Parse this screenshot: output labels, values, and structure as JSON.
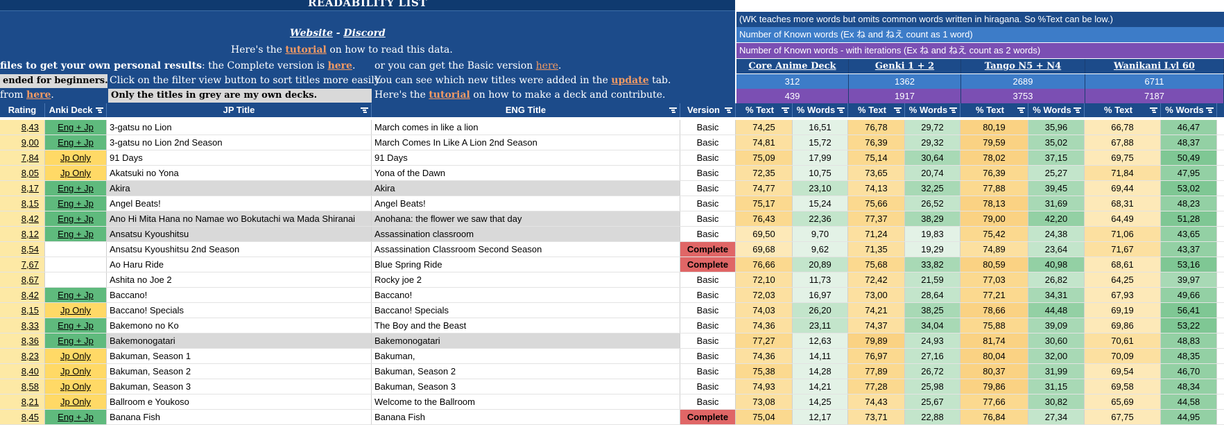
{
  "header": {
    "title": "READABILITY LIST",
    "website": "Website",
    "dash": " - ",
    "discord": "Discord",
    "read_line_pre": "Here's the ",
    "read_link": "tutorial",
    "read_line_post": " on how to read this data.",
    "profiles_pre": "files to get your own personal results",
    "profiles_mid": ": the Complete version is ",
    "profiles_link": "here",
    "profiles_post": ".",
    "basic_pre": "or you can get the Basic version ",
    "basic_link": "here",
    "basic_post": ".",
    "beginners": "ended for beginners.",
    "filter_hint": "Click on the filter view button to sort titles more easily.",
    "new_titles_pre": "You can see which new titles were added in the ",
    "new_titles_link": "update",
    "new_titles_post": " tab.",
    "from_pre": " from ",
    "from_link": "here",
    "from_post": ".",
    "grey_note": "Only the titles in grey are my own decks.",
    "deck_pre": "Here's the ",
    "deck_link": "tutorial",
    "deck_post": " on how to make a deck and contribute."
  },
  "right_header": {
    "wk_note": "(WK teaches more words but omits common words written in hiragana. So %Text can be low.)",
    "known_words": "Number of Known words (Ex ね and ねえ count as 1 word)",
    "known_words_iter": "Number of Known words - with iterations (Ex ね and ねえ count as 2 words)",
    "decks": [
      {
        "name": "Core Anime Deck",
        "known": "312",
        "known_iter": "439"
      },
      {
        "name": "Genki 1 + 2",
        "known": "1362",
        "known_iter": "1917"
      },
      {
        "name": "Tango N5 + N4",
        "known": "2689",
        "known_iter": "3753"
      },
      {
        "name": "Wanikani Lvl 60",
        "known": "6711",
        "known_iter": "7187"
      }
    ]
  },
  "columns": {
    "rating": "Rating",
    "anki": "Anki Deck",
    "jp": "JP Title",
    "en": "ENG Title",
    "version": "Version",
    "text": "% Text",
    "words": "% Words"
  },
  "rows": [
    {
      "rating": "8,43",
      "anki": "Eng + Jp",
      "jp": "3-gatsu no Lion",
      "en": "March comes in like a lion",
      "version": "Basic",
      "grey": false,
      "v": [
        "74,25",
        "16,51",
        "76,78",
        "29,72",
        "80,19",
        "35,96",
        "66,78",
        "46,47"
      ]
    },
    {
      "rating": "9,00",
      "anki": "Eng + Jp",
      "jp": "3-gatsu no Lion 2nd Season",
      "en": "March Comes In Like A Lion 2nd Season",
      "version": "Basic",
      "grey": false,
      "v": [
        "74,81",
        "15,72",
        "76,39",
        "29,32",
        "79,59",
        "35,02",
        "67,88",
        "48,37"
      ]
    },
    {
      "rating": "7,84",
      "anki": "Jp Only",
      "jp": "91 Days",
      "en": "91 Days",
      "version": "Basic",
      "grey": false,
      "v": [
        "75,09",
        "17,99",
        "75,14",
        "30,64",
        "78,02",
        "37,15",
        "69,75",
        "50,49"
      ]
    },
    {
      "rating": "8,05",
      "anki": "Jp Only",
      "jp": "Akatsuki no Yona",
      "en": "Yona of the Dawn",
      "version": "Basic",
      "grey": false,
      "v": [
        "72,35",
        "10,75",
        "73,65",
        "20,74",
        "76,39",
        "25,27",
        "71,84",
        "47,95"
      ]
    },
    {
      "rating": "8,17",
      "anki": "Eng + Jp",
      "jp": "Akira",
      "en": "Akira",
      "version": "Basic",
      "grey": true,
      "v": [
        "74,77",
        "23,10",
        "74,13",
        "32,25",
        "77,88",
        "39,45",
        "69,44",
        "53,02"
      ]
    },
    {
      "rating": "8,15",
      "anki": "Eng + Jp",
      "jp": "Angel Beats!",
      "en": "Angel Beats!",
      "version": "Basic",
      "grey": false,
      "v": [
        "75,17",
        "15,24",
        "75,66",
        "26,52",
        "78,13",
        "31,69",
        "68,31",
        "48,23"
      ]
    },
    {
      "rating": "8,42",
      "anki": "Eng + Jp",
      "jp": "Ano Hi Mita Hana no Namae wo Bokutachi wa Mada Shiranai",
      "en": "Anohana: the flower we saw that day",
      "version": "Basic",
      "grey": true,
      "v": [
        "76,43",
        "22,36",
        "77,37",
        "38,29",
        "79,00",
        "42,20",
        "64,49",
        "51,28"
      ]
    },
    {
      "rating": "8,12",
      "anki": "Eng + Jp",
      "jp": "Ansatsu Kyoushitsu",
      "en": "Assassination classroom",
      "version": "Basic",
      "grey": true,
      "v": [
        "69,50",
        "9,70",
        "71,24",
        "19,83",
        "75,42",
        "24,38",
        "71,06",
        "43,65"
      ]
    },
    {
      "rating": "8,54",
      "anki": "",
      "jp": "Ansatsu Kyoushitsu 2nd Season",
      "en": "Assassination Classroom Second Season",
      "version": "Complete",
      "grey": false,
      "v": [
        "69,68",
        "9,62",
        "71,35",
        "19,29",
        "74,89",
        "23,64",
        "71,67",
        "43,37"
      ]
    },
    {
      "rating": "7,67",
      "anki": "",
      "jp": "Ao Haru Ride",
      "en": "Blue Spring Ride",
      "version": "Complete",
      "grey": false,
      "v": [
        "76,66",
        "20,89",
        "75,68",
        "33,82",
        "80,59",
        "40,98",
        "68,61",
        "53,16"
      ]
    },
    {
      "rating": "8,67",
      "anki": "",
      "jp": "Ashita no Joe 2",
      "en": "Rocky joe 2",
      "version": "Basic",
      "grey": false,
      "v": [
        "72,10",
        "11,73",
        "72,42",
        "21,59",
        "77,03",
        "26,82",
        "64,25",
        "39,97"
      ]
    },
    {
      "rating": "8,42",
      "anki": "Eng + Jp",
      "jp": "Baccano!",
      "en": "Baccano!",
      "version": "Basic",
      "grey": false,
      "v": [
        "72,03",
        "16,97",
        "73,00",
        "28,64",
        "77,21",
        "34,31",
        "67,93",
        "49,66"
      ]
    },
    {
      "rating": "8,15",
      "anki": "Jp Only",
      "jp": "Baccano! Specials",
      "en": "Baccano! Specials",
      "version": "Basic",
      "grey": false,
      "v": [
        "74,03",
        "26,20",
        "74,21",
        "38,25",
        "78,66",
        "44,48",
        "69,19",
        "56,41"
      ]
    },
    {
      "rating": "8,33",
      "anki": "Eng + Jp",
      "jp": "Bakemono no Ko",
      "en": "The Boy and the Beast",
      "version": "Basic",
      "grey": false,
      "v": [
        "74,36",
        "23,11",
        "74,37",
        "34,04",
        "75,88",
        "39,09",
        "69,86",
        "53,22"
      ]
    },
    {
      "rating": "8,36",
      "anki": "Eng + Jp",
      "jp": "Bakemonogatari",
      "en": "Bakemonogatari",
      "version": "Basic",
      "grey": true,
      "v": [
        "77,27",
        "12,63",
        "79,89",
        "24,93",
        "81,74",
        "30,60",
        "70,61",
        "48,83"
      ]
    },
    {
      "rating": "8,23",
      "anki": "Jp Only",
      "jp": "Bakuman, Season 1",
      "en": "Bakuman,",
      "version": "Basic",
      "grey": false,
      "v": [
        "74,36",
        "14,11",
        "76,97",
        "27,16",
        "80,04",
        "32,00",
        "70,09",
        "48,35"
      ]
    },
    {
      "rating": "8,40",
      "anki": "Jp Only",
      "jp": "Bakuman, Season 2",
      "en": "Bakuman, Season 2",
      "version": "Basic",
      "grey": false,
      "v": [
        "75,38",
        "14,28",
        "77,89",
        "26,72",
        "80,37",
        "31,99",
        "69,54",
        "46,70"
      ]
    },
    {
      "rating": "8,58",
      "anki": "Jp Only",
      "jp": "Bakuman, Season 3",
      "en": "Bakuman, Season 3",
      "version": "Basic",
      "grey": false,
      "v": [
        "74,93",
        "14,21",
        "77,28",
        "25,98",
        "79,86",
        "31,15",
        "69,58",
        "48,34"
      ]
    },
    {
      "rating": "8,21",
      "anki": "Jp Only",
      "jp": "Ballroom e Youkoso",
      "en": "Welcome to the Ballroom",
      "version": "Basic",
      "grey": false,
      "v": [
        "73,08",
        "14,25",
        "74,43",
        "25,67",
        "77,66",
        "30,82",
        "65,69",
        "44,58"
      ]
    },
    {
      "rating": "8,45",
      "anki": "Eng + Jp",
      "jp": "Banana Fish",
      "en": "Banana Fish",
      "version": "Complete",
      "grey": false,
      "v": [
        "75,04",
        "12,17",
        "73,71",
        "22,88",
        "76,84",
        "27,34",
        "67,75",
        "44,95"
      ]
    }
  ],
  "colors": {
    "header_blue": "#1c4b8a",
    "row_blue": "#3d7cc8",
    "row_purple": "#7b4fb3",
    "link_orange": "#f29a64",
    "complete_red": "#e06666",
    "anki_green": "#5fba7d",
    "anki_yellow": "#ffd966",
    "rating_yellow": "#fde9a5"
  },
  "icons": {
    "filter": "filter-icon"
  }
}
